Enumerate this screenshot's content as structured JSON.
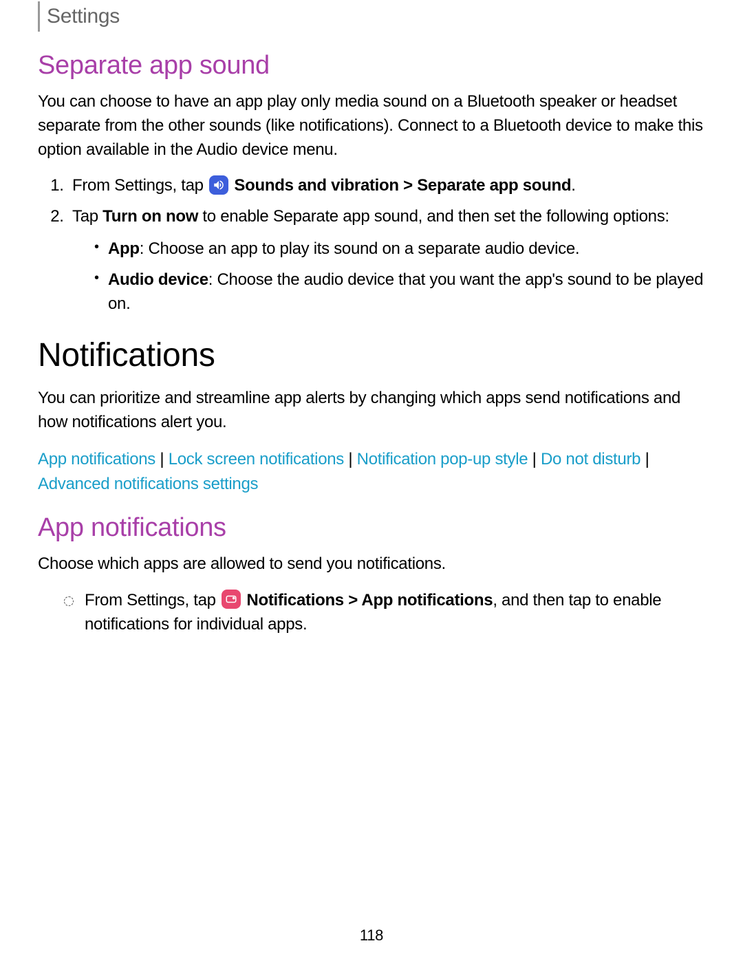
{
  "header": {
    "breadcrumb": "Settings"
  },
  "section1": {
    "title": "Separate app sound",
    "intro": "You can choose to have an app play only media sound on a Bluetooth speaker or headset separate from the other sounds (like notifications). Connect to a Bluetooth device to make this option available in the Audio device menu.",
    "step1_prefix": "From Settings, tap ",
    "step1_bold_path": "Sounds and vibration > Separate app sound",
    "step1_suffix": ".",
    "step2_prefix": "Tap ",
    "step2_bold1": "Turn on now",
    "step2_suffix": " to enable Separate app sound, and then set the following options:",
    "sub_app_label": "App",
    "sub_app_text": ": Choose an app to play its sound on a separate audio device.",
    "sub_audio_label": "Audio device",
    "sub_audio_text": ": Choose the audio device that you want the app's sound to be played on."
  },
  "section2": {
    "title": "Notifications",
    "intro": "You can prioritize and streamline app alerts by changing which apps send notifications and how notifications alert you.",
    "links": {
      "l1": "App notifications",
      "l2": "Lock screen notifications",
      "l3": "Notification pop-up style",
      "l4": "Do not disturb",
      "l5": "Advanced notifications settings"
    },
    "sep": " | "
  },
  "section3": {
    "title": "App notifications",
    "intro": "Choose which apps are allowed to send you notifications.",
    "step_prefix": "From Settings, tap ",
    "step_bold_path": "Notifications > App notifications",
    "step_suffix": ", and then tap to enable notifications for individual apps."
  },
  "footer": {
    "page": "118"
  }
}
